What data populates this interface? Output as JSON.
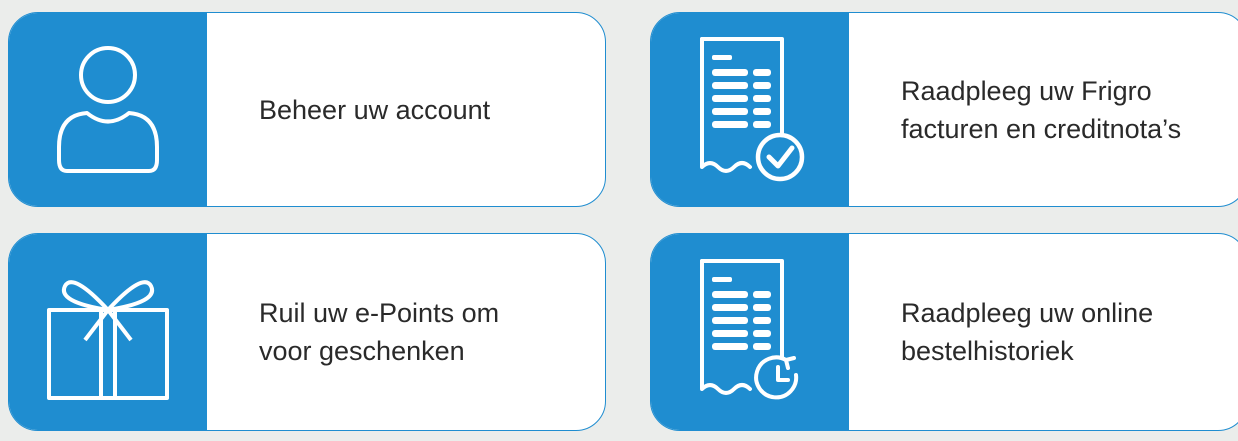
{
  "accent_color": "#1f8dd0",
  "cards": [
    {
      "label": "Beheer uw account",
      "icon": "user-icon"
    },
    {
      "label": "Raadpleeg uw Frigro\nfacturen en creditnota’s",
      "icon": "invoice-check-icon"
    },
    {
      "label": "Ruil uw e-Points om\nvoor geschenken",
      "icon": "gift-icon"
    },
    {
      "label": "Raadpleeg uw online\nbestelhistoriek",
      "icon": "order-history-icon"
    }
  ]
}
